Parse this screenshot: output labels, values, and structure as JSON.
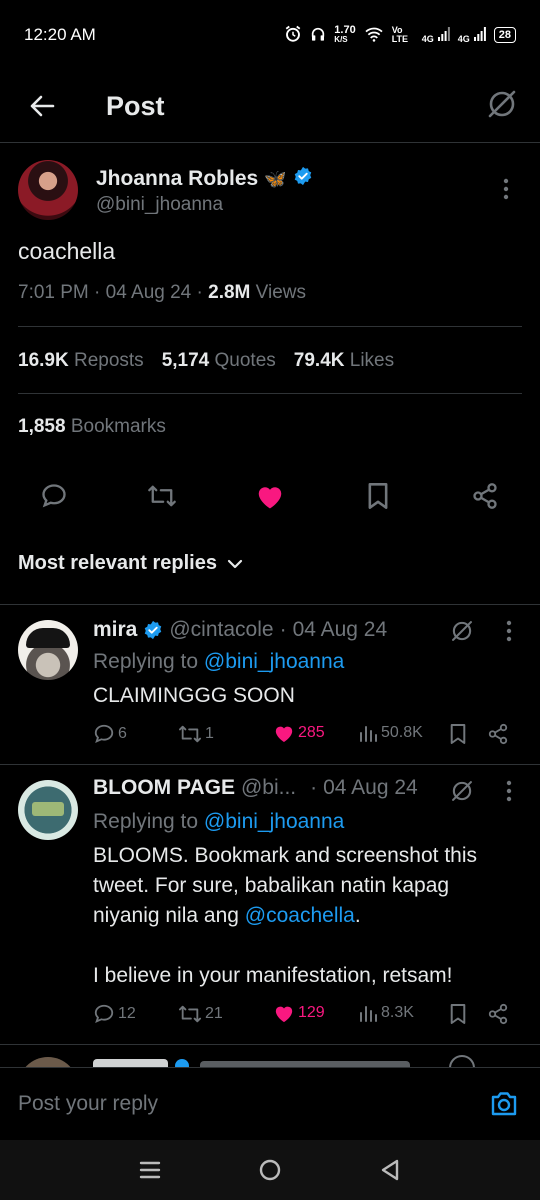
{
  "status": {
    "time": "12:20 AM",
    "speed": "1.70",
    "speed_unit": "K/S",
    "net1": "Vo LTE",
    "net2": "4G",
    "net3": "4G",
    "battery": "28"
  },
  "header": {
    "title": "Post"
  },
  "post": {
    "author_name": "Jhoanna Robles",
    "author_emoji": "🦋",
    "author_handle": "@bini_jhoanna",
    "text": "coachella",
    "time": "7:01 PM",
    "date": "04 Aug 24",
    "views_count": "2.8M",
    "views_label": "Views",
    "reposts_count": "16.9K",
    "reposts_label": "Reposts",
    "quotes_count": "5,174",
    "quotes_label": "Quotes",
    "likes_count": "79.4K",
    "likes_label": "Likes",
    "bookmarks_count": "1,858",
    "bookmarks_label": "Bookmarks"
  },
  "sort_label": "Most relevant replies",
  "replies": [
    {
      "name": "mira",
      "handle": "@cintacole",
      "date": "04 Aug 24",
      "replying_label": "Replying to",
      "replying_to": "@bini_jhoanna",
      "text": "CLAIMINGGG SOON",
      "comments": "6",
      "reposts": "1",
      "likes": "285",
      "views": "50.8K"
    },
    {
      "name": "BLOOM PAGE",
      "handle": "@bi...",
      "date": "04 Aug 24",
      "replying_label": "Replying to",
      "replying_to": "@bini_jhoanna",
      "text_line1": "BLOOMS. Bookmark and screenshot this",
      "text_line2": "tweet. For sure, babalikan natin kapag",
      "text_line3_pre": "niyanig nila ang ",
      "text_line3_link": "@coachella",
      "text_line3_post": ".",
      "text_line4": "I believe in your manifestation, retsam!",
      "comments": "12",
      "reposts": "21",
      "likes": "129",
      "views": "8.3K"
    }
  ],
  "composer": {
    "placeholder": "Post your reply"
  },
  "colors": {
    "accent": "#1d9bf0",
    "like": "#f91880",
    "muted": "#71767b",
    "text": "#e7e9ea"
  }
}
